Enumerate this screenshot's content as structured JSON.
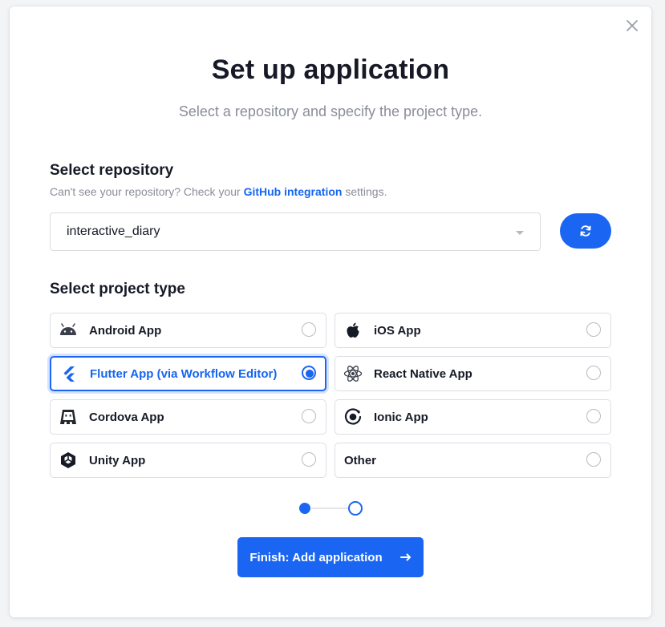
{
  "modal": {
    "title": "Set up application",
    "subtitle": "Select a repository and specify the project type."
  },
  "repository": {
    "section_title": "Select repository",
    "hint_prefix": "Can't see your repository? Check your ",
    "hint_link": "GitHub integration",
    "hint_suffix": " settings.",
    "selected_value": "interactive_diary"
  },
  "project_type": {
    "section_title": "Select project type",
    "options": [
      {
        "label": "Android App",
        "icon": "android-icon",
        "selected": false
      },
      {
        "label": "iOS App",
        "icon": "apple-icon",
        "selected": false
      },
      {
        "label": "Flutter App (via Workflow Editor)",
        "icon": "flutter-icon",
        "selected": true
      },
      {
        "label": "React Native App",
        "icon": "react-icon",
        "selected": false
      },
      {
        "label": "Cordova App",
        "icon": "cordova-icon",
        "selected": false
      },
      {
        "label": "Ionic App",
        "icon": "ionic-icon",
        "selected": false
      },
      {
        "label": "Unity App",
        "icon": "unity-icon",
        "selected": false
      },
      {
        "label": "Other",
        "icon": "",
        "selected": false
      }
    ]
  },
  "stepper": {
    "current_step": 1,
    "total_steps": 2
  },
  "actions": {
    "finish_label": "Finish: Add application"
  },
  "colors": {
    "accent": "#1a66f2",
    "text": "#161a26",
    "muted": "#8a8e99"
  }
}
